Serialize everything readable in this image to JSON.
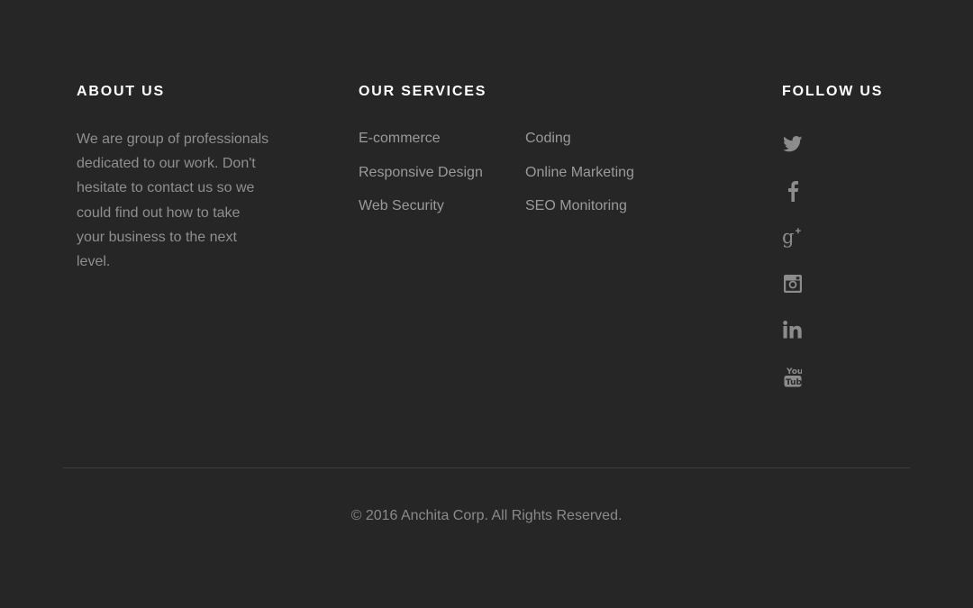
{
  "colors": {
    "background": "#262626",
    "heading": "#ffffff",
    "text": "#9a9a9a",
    "icon": "#8c8c8c",
    "divider": "#3d3d3d"
  },
  "about": {
    "heading": "ABOUT US",
    "text": "We are group of professionals dedicated to our work. Don't hesitate to contact us so we could find out how to take your business to the next level."
  },
  "services": {
    "heading": "OUR SERVICES",
    "column1": [
      "E-commerce",
      "Responsive Design",
      "Web Security"
    ],
    "column2": [
      "Coding",
      "Online Marketing",
      "SEO Monitoring"
    ]
  },
  "follow": {
    "heading": "FOLLOW US",
    "icons": [
      "twitter-icon",
      "facebook-icon",
      "google-plus-icon",
      "instagram-icon",
      "linkedin-icon",
      "youtube-icon"
    ]
  },
  "footer": {
    "copyright": "© 2016 Anchita Corp. All Rights Reserved."
  }
}
